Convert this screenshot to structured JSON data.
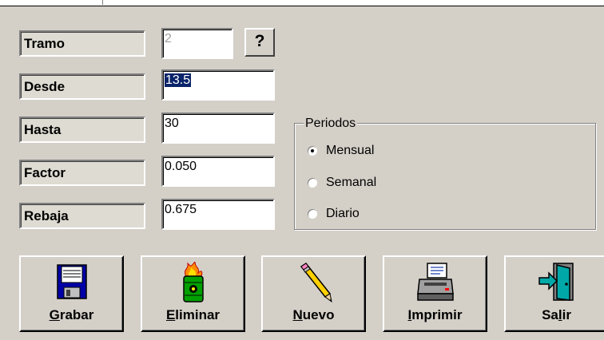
{
  "fields": [
    {
      "label": "Tramo",
      "value": "2",
      "state": "disabled"
    },
    {
      "label": "Desde",
      "value": "13.5",
      "state": "selected"
    },
    {
      "label": "Hasta",
      "value": "30",
      "state": "normal"
    },
    {
      "label": "Factor",
      "value": "0.050",
      "state": "normal"
    },
    {
      "label": "Rebaja",
      "value": "0.675",
      "state": "normal"
    }
  ],
  "help_button": "?",
  "periodos": {
    "title": "Periodos",
    "options": [
      "Mensual",
      "Semanal",
      "Diario"
    ],
    "selected": "Mensual"
  },
  "buttons": [
    {
      "mnemonic": "G",
      "rest": "rabar",
      "icon": "floppy-disk-icon"
    },
    {
      "mnemonic": "E",
      "rest": "liminar",
      "icon": "burning-trash-barrel-icon"
    },
    {
      "mnemonic": "N",
      "rest": "uevo",
      "icon": "pencil-icon"
    },
    {
      "mnemonic": "I",
      "rest": "mprimir",
      "icon": "printer-icon"
    },
    {
      "prefix": "Sa",
      "mnemonic": "l",
      "rest": "ir",
      "icon": "exit-door-icon"
    }
  ],
  "colors": {
    "face": "#d4d0c8",
    "selection": "#0a246a",
    "label_bg": "#dedbd2"
  }
}
